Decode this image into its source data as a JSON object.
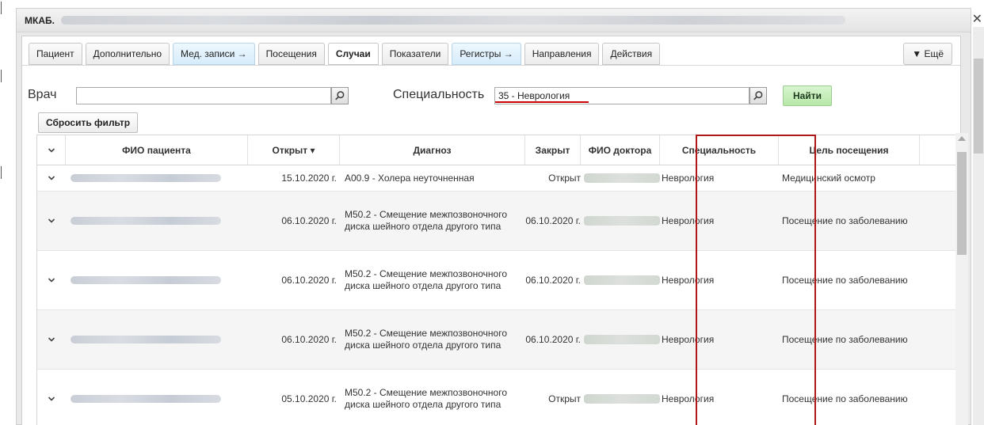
{
  "window": {
    "title": "МКАБ."
  },
  "tabs": [
    {
      "label": "Пациент",
      "style": "normal"
    },
    {
      "label": "Дополнительно",
      "style": "normal"
    },
    {
      "label": "Мед. записи →",
      "style": "blue"
    },
    {
      "label": "Посещения",
      "style": "normal"
    },
    {
      "label": "Случаи",
      "style": "active"
    },
    {
      "label": "Показатели",
      "style": "normal"
    },
    {
      "label": "Регистры →",
      "style": "blue"
    },
    {
      "label": "Направления",
      "style": "normal"
    },
    {
      "label": "Действия",
      "style": "normal"
    }
  ],
  "more_tab": "▼ Ещё",
  "filter": {
    "doctor_label": "Врач",
    "doctor_value": "",
    "specialty_label": "Специальность",
    "specialty_value": "35 - Неврология",
    "find_label": "Найти",
    "reset_label": "Сбросить фильтр"
  },
  "table": {
    "columns": [
      "ФИО пациента",
      "Открыт ▾",
      "Диагноз",
      "Закрыт",
      "ФИО доктора",
      "Специальность",
      "Цель посещения"
    ],
    "rows": [
      {
        "opened": "15.10.2020 г.",
        "diagnosis": "A00.9 - Холера неуточненная",
        "closed": "Открыт",
        "specialty": "Неврология",
        "aim": "Медицинский осмотр"
      },
      {
        "opened": "06.10.2020 г.",
        "diagnosis": "M50.2 - Смещение межпозвоночного диска шейного отдела другого типа",
        "closed": "06.10.2020 г.",
        "specialty": "Неврология",
        "aim": "Посещение по заболеванию"
      },
      {
        "opened": "06.10.2020 г.",
        "diagnosis": "M50.2 - Смещение межпозвоночного диска шейного отдела другого типа",
        "closed": "06.10.2020 г.",
        "specialty": "Неврология",
        "aim": "Посещение по заболеванию"
      },
      {
        "opened": "06.10.2020 г.",
        "diagnosis": "M50.2 - Смещение межпозвоночного диска шейного отдела другого типа",
        "closed": "06.10.2020 г.",
        "specialty": "Неврология",
        "aim": "Посещение по заболеванию"
      },
      {
        "opened": "05.10.2020 г.",
        "diagnosis": "M50.2 - Смещение межпозвоночного диска шейного отдела другого типа",
        "closed": "Открыт",
        "specialty": "Неврология",
        "aim": "Посещение по заболеванию"
      }
    ]
  },
  "colors": {
    "highlight_frame": "#b01818",
    "find_button": "#b8e8a9",
    "blue_tab": "#d6ecfa"
  }
}
